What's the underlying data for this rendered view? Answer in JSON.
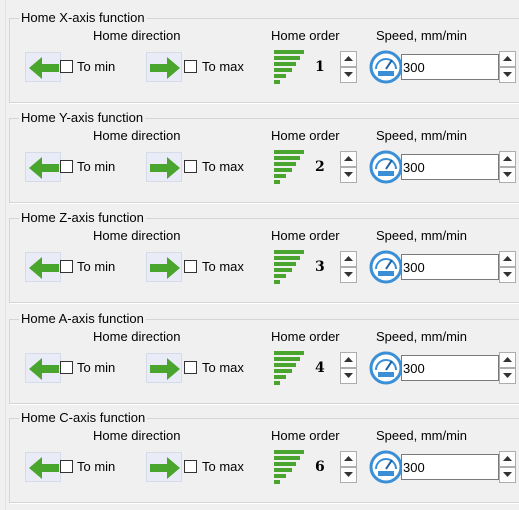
{
  "colors": {
    "arrow_green": "#4aa52e",
    "gauge_blue": "#3a8fd6",
    "order_green": "#4aa52e"
  },
  "icons": {
    "arrow_left": "arrow-left-icon",
    "arrow_right": "arrow-right-icon",
    "home_order": "stacked-bars-icon",
    "speed": "gauge-icon",
    "spin_up": "chevron-up-icon",
    "spin_down": "chevron-down-icon"
  },
  "groups": [
    {
      "title": "Home X-axis function",
      "home_direction_label": "Home direction",
      "home_order_label": "Home order",
      "speed_label": "Speed, mm/min",
      "to_min_label": "To min",
      "to_max_label": "To max",
      "to_min_checked": false,
      "to_max_checked": false,
      "home_order": "1",
      "speed": "300"
    },
    {
      "title": "Home Y-axis function",
      "home_direction_label": "Home direction",
      "home_order_label": "Home order",
      "speed_label": "Speed, mm/min",
      "to_min_label": "To min",
      "to_max_label": "To max",
      "to_min_checked": false,
      "to_max_checked": false,
      "home_order": "2",
      "speed": "300"
    },
    {
      "title": "Home Z-axis function",
      "home_direction_label": "Home direction",
      "home_order_label": "Home order",
      "speed_label": "Speed, mm/min",
      "to_min_label": "To min",
      "to_max_label": "To max",
      "to_min_checked": false,
      "to_max_checked": false,
      "home_order": "3",
      "speed": "300"
    },
    {
      "title": "Home A-axis function",
      "home_direction_label": "Home direction",
      "home_order_label": "Home order",
      "speed_label": "Speed, mm/min",
      "to_min_label": "To min",
      "to_max_label": "To max",
      "to_min_checked": false,
      "to_max_checked": false,
      "home_order": "4",
      "speed": "300"
    },
    {
      "title": "Home C-axis function",
      "home_direction_label": "Home direction",
      "home_order_label": "Home order",
      "speed_label": "Speed, mm/min",
      "to_min_label": "To min",
      "to_max_label": "To max",
      "to_min_checked": false,
      "to_max_checked": false,
      "home_order": "6",
      "speed": "300"
    }
  ]
}
